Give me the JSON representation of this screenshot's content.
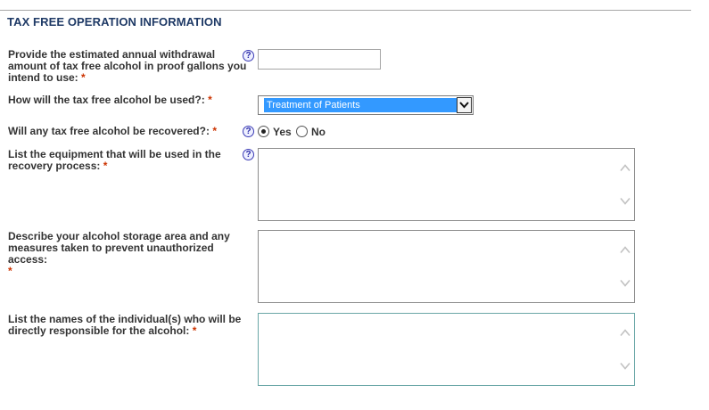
{
  "section": {
    "title": "TAX FREE OPERATION INFORMATION"
  },
  "required_marker": "*",
  "help_glyph": "?",
  "fields": {
    "withdrawal": {
      "label": "Provide the estimated annual withdrawal amount of tax free alcohol in proof gallons you intend to use:",
      "value": ""
    },
    "usage": {
      "label": "How will the tax free alcohol be used?:",
      "selected": "Treatment of Patients"
    },
    "recovered": {
      "label": "Will any tax free alcohol be recovered?:",
      "options": [
        "Yes",
        "No"
      ],
      "selected": "Yes"
    },
    "equipment": {
      "label": "List the equipment that will be used in the recovery process:",
      "value": ""
    },
    "storage": {
      "label": "Describe your alcohol storage area and any measures taken to prevent unauthorized access:",
      "value": ""
    },
    "responsible": {
      "label": "List the names of the individual(s) who will be directly responsible for the alcohol:",
      "value": ""
    }
  },
  "colors": {
    "title": "#1f3a66",
    "required": "#cc3300",
    "select_highlight": "#3399ff",
    "help_icon": "#2a2aa8"
  }
}
